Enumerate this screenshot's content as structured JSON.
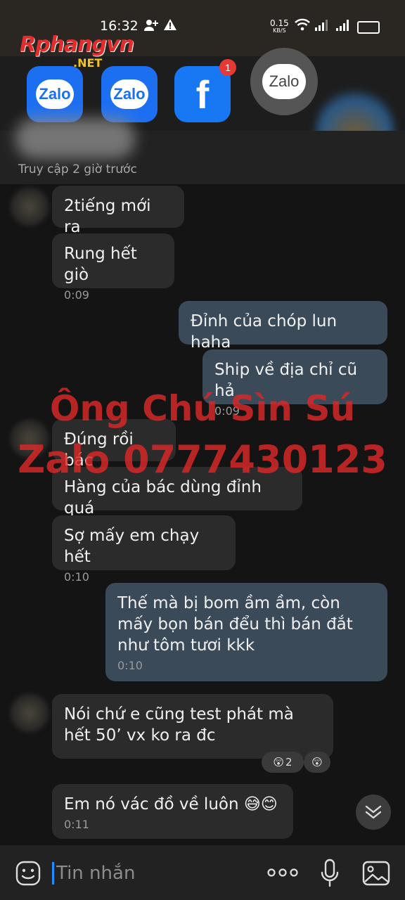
{
  "status_bar": {
    "time": "16:32",
    "speed_value": "0.15",
    "speed_unit": "KB/S"
  },
  "watermark_logo": {
    "brand": "Rphangvn",
    "suffix": ".NET"
  },
  "bubble_apps": [
    {
      "name": "zalo-app-1",
      "label": "Zalo"
    },
    {
      "name": "zalo-app-2",
      "label": "Zalo"
    },
    {
      "name": "facebook-app",
      "label": "f",
      "badge": "1"
    },
    {
      "name": "zalo-floating",
      "label": "Zalo"
    }
  ],
  "header": {
    "last_seen": "Truy cập 2 giờ trước",
    "call_icon": "phone-icon",
    "video_icon": "video-camera-icon",
    "menu_icon": "list-menu-icon"
  },
  "messages": [
    {
      "direction": "in",
      "text": "2tiếng mới ra",
      "time": ""
    },
    {
      "direction": "in",
      "text": "Rung hết giò",
      "time": "0:09"
    },
    {
      "direction": "out",
      "text": "Đỉnh của chóp lun haha",
      "time": ""
    },
    {
      "direction": "out",
      "text": "Ship về địa chỉ cũ hả",
      "time": "0:09"
    },
    {
      "direction": "in",
      "text": "Đúng rồi bác",
      "time": ""
    },
    {
      "direction": "in",
      "text": "Hàng của bác dùng đỉnh quá",
      "time": ""
    },
    {
      "direction": "in",
      "text": "Sợ mấy em chạy hết",
      "time": "0:10"
    },
    {
      "direction": "out",
      "text": "Thế mà bị bom ầm ầm, còn mấy bọn bán đểu thì bán đắt như tôm tươi kkk",
      "time": "0:10"
    },
    {
      "direction": "in",
      "text": "Nói chứ e cũng test phát mà hết 50’ vx ko ra đc",
      "time": "",
      "reaction_count": "2"
    },
    {
      "direction": "in",
      "text": "Em nó vác đồ về luôn 😅😊",
      "time": "0:11"
    }
  ],
  "overlay_watermark": {
    "line1": "Ông Chú Sìn Sú",
    "line2": "Zalo 0777430123"
  },
  "composer": {
    "placeholder": "Tin nhắn",
    "emoji_icon": "emoji-icon",
    "more_icon": "more-dots-icon",
    "mic_icon": "microphone-icon",
    "image_icon": "image-icon"
  },
  "colors": {
    "incoming_bubble": "#2b2b2b",
    "outgoing_bubble": "#3b4a58",
    "watermark_red": "#dc2828",
    "accent_blue": "#1f8fff"
  }
}
